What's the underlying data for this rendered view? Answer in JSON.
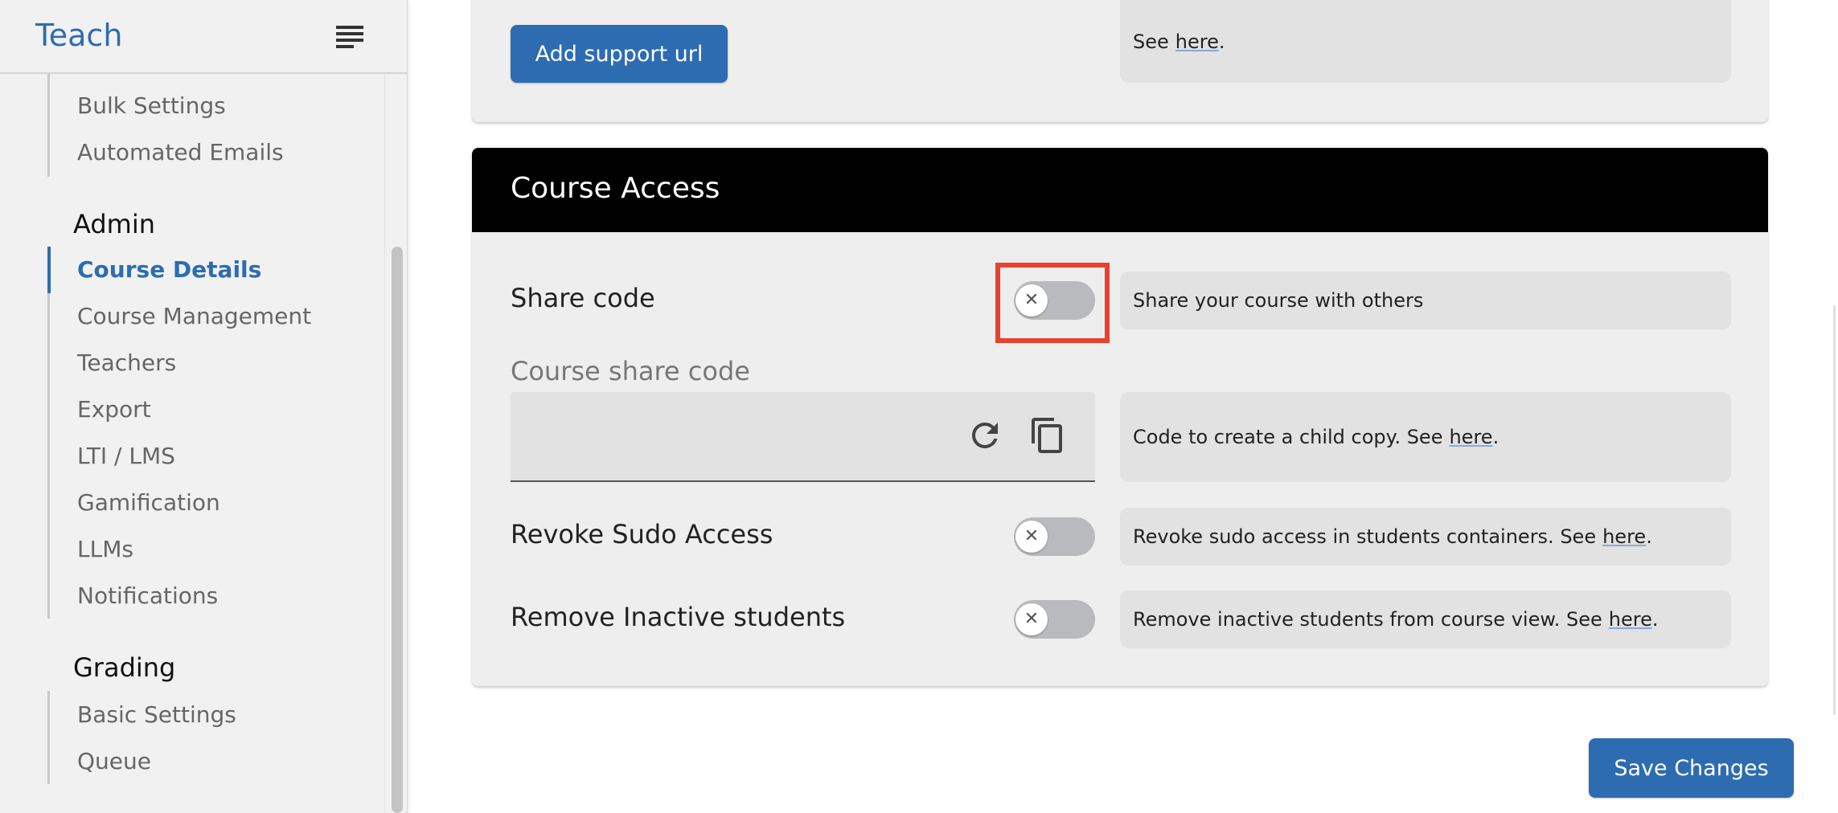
{
  "sidebar": {
    "brand": "Teach",
    "items_top": [
      "Bulk Settings",
      "Automated Emails"
    ],
    "admin_title": "Admin",
    "admin_items": [
      "Course Details",
      "Course Management",
      "Teachers",
      "Export",
      "LTI / LMS",
      "Gamification",
      "LLMs",
      "Notifications"
    ],
    "grading_title": "Grading",
    "grading_items": [
      "Basic Settings",
      "Queue"
    ]
  },
  "support": {
    "button": "Add support url",
    "help_prefix": "See",
    "help_link": "here",
    "help_suffix": "."
  },
  "access": {
    "title": "Course Access",
    "share_code_label": "Share code",
    "share_code_help": "Share your course with others",
    "share_code_field_label": "Course share code",
    "share_code_field_help": "Code to create a child copy. See",
    "revoke_label": "Revoke Sudo Access",
    "revoke_help": "Revoke sudo access in students containers. See",
    "remove_label": "Remove Inactive students",
    "remove_help": "Remove inactive students from course view. See",
    "link": "here",
    "period": "."
  },
  "save_button": "Save Changes",
  "colors": {
    "accent": "#2d6cb0",
    "highlight": "#e8412e",
    "header_bg": "#000000"
  }
}
